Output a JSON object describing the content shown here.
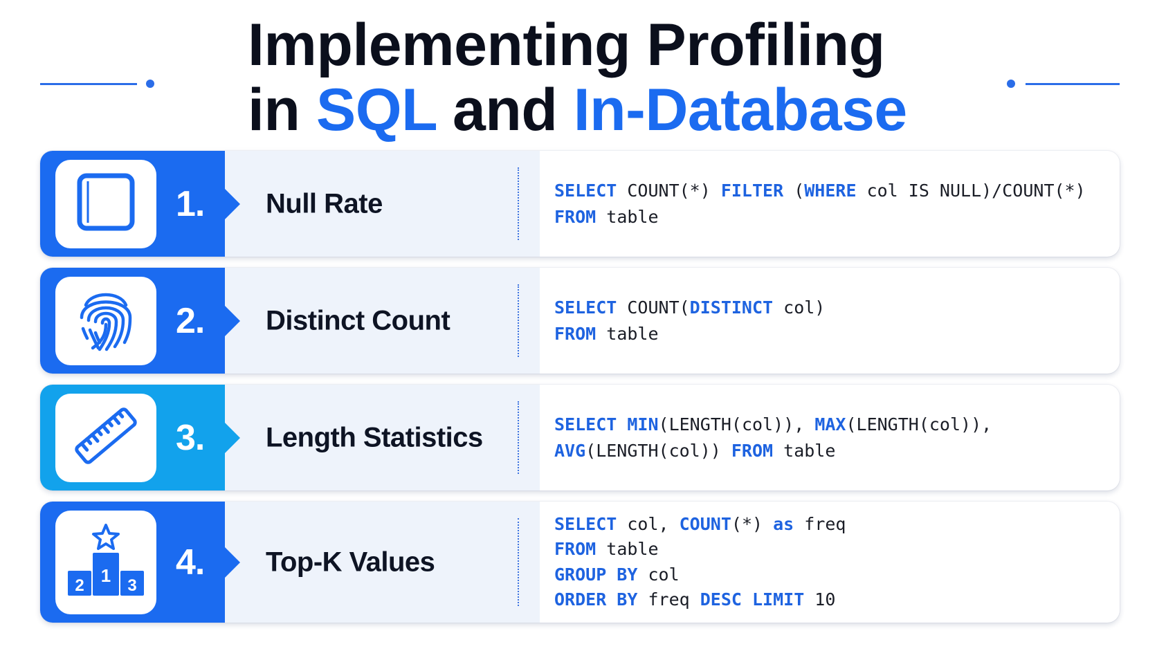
{
  "title": {
    "line1": "Implementing Profiling",
    "line2_prefix": "in ",
    "line2_accent1": "SQL",
    "line2_mid": " and ",
    "line2_accent2": "In-Database"
  },
  "colors": {
    "primary_blue": "#1b6bf0",
    "light_blue": "#12a2ec",
    "keyword_blue": "#1e63e0",
    "band_bg": "#eef3fb"
  },
  "rows": [
    {
      "number": "1.",
      "metric": "Null Rate",
      "icon": "square-icon",
      "code": [
        [
          {
            "t": "SELECT",
            "kw": true
          },
          {
            "t": " COUNT(*) "
          },
          {
            "t": "FILTER",
            "kw": true
          },
          {
            "t": " ("
          },
          {
            "t": "WHERE",
            "kw": true
          },
          {
            "t": " col IS NULL)/COUNT(*)"
          }
        ],
        [
          {
            "t": "FROM",
            "kw": true
          },
          {
            "t": " table"
          }
        ]
      ]
    },
    {
      "number": "2.",
      "metric": "Distinct Count",
      "icon": "fingerprint-icon",
      "code": [
        [
          {
            "t": "SELECT",
            "kw": true
          },
          {
            "t": " COUNT("
          },
          {
            "t": "DISTINCT",
            "kw": true
          },
          {
            "t": " col)"
          }
        ],
        [
          {
            "t": "FROM",
            "kw": true
          },
          {
            "t": " table"
          }
        ]
      ]
    },
    {
      "number": "3.",
      "metric": "Length Statistics",
      "icon": "ruler-icon",
      "code": [
        [
          {
            "t": "SELECT",
            "kw": true
          },
          {
            "t": " "
          },
          {
            "t": "MIN",
            "kw": true
          },
          {
            "t": "(LENGTH(col)), "
          },
          {
            "t": "MAX",
            "kw": true
          },
          {
            "t": "(LENGTH(col)),"
          }
        ],
        [
          {
            "t": "AVG",
            "kw": true
          },
          {
            "t": "(LENGTH(col)) "
          },
          {
            "t": "FROM",
            "kw": true
          },
          {
            "t": " table"
          }
        ]
      ]
    },
    {
      "number": "4.",
      "metric": "Top-K Values",
      "icon": "podium-icon",
      "podium_labels": [
        "1",
        "2",
        "3"
      ],
      "code": [
        [
          {
            "t": "SELECT",
            "kw": true
          },
          {
            "t": " col, "
          },
          {
            "t": "COUNT",
            "kw": true
          },
          {
            "t": "(*) "
          },
          {
            "t": "as",
            "kw": true
          },
          {
            "t": " freq"
          }
        ],
        [
          {
            "t": "FROM",
            "kw": true
          },
          {
            "t": " table"
          }
        ],
        [
          {
            "t": "GROUP BY",
            "kw": true
          },
          {
            "t": " col"
          }
        ],
        [
          {
            "t": "ORDER BY",
            "kw": true
          },
          {
            "t": " freq "
          },
          {
            "t": "DESC LIMIT",
            "kw": true
          },
          {
            "t": " 10"
          }
        ]
      ]
    }
  ]
}
